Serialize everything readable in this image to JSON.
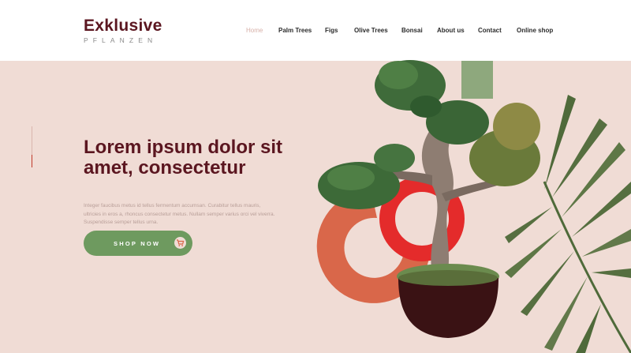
{
  "logo": {
    "main": "Exklusive",
    "sub": "PFLANZEN"
  },
  "nav": {
    "items": [
      {
        "label": "Home",
        "active": true
      },
      {
        "label": "Palm Trees",
        "active": false
      },
      {
        "label": "Figs",
        "active": false
      },
      {
        "label": "Olive Trees",
        "active": false
      },
      {
        "label": "Bonsai",
        "active": false
      },
      {
        "label": "About us",
        "active": false
      },
      {
        "label": "Contact",
        "active": false
      },
      {
        "label": "Online shop",
        "active": false
      }
    ]
  },
  "hero": {
    "headline": "Lorem ipsum dolor sit amet, consectetur",
    "body": "Integer faucibus metus id tellus fermentum accumsan. Curabitur tellus mauris, ultricies in eros a, rhoncus consectetur metus. Nullam semper varius orci vel viverra. Suspendisse semper tellus urna.",
    "button_label": "SHOP NOW",
    "button_icon": "shopping-cart-icon"
  },
  "colors": {
    "background": "#f0dcd5",
    "brand": "#5b1620",
    "accent_green": "#6e9a5f",
    "accent_red": "#e03030",
    "accent_orange": "#d9674a"
  }
}
